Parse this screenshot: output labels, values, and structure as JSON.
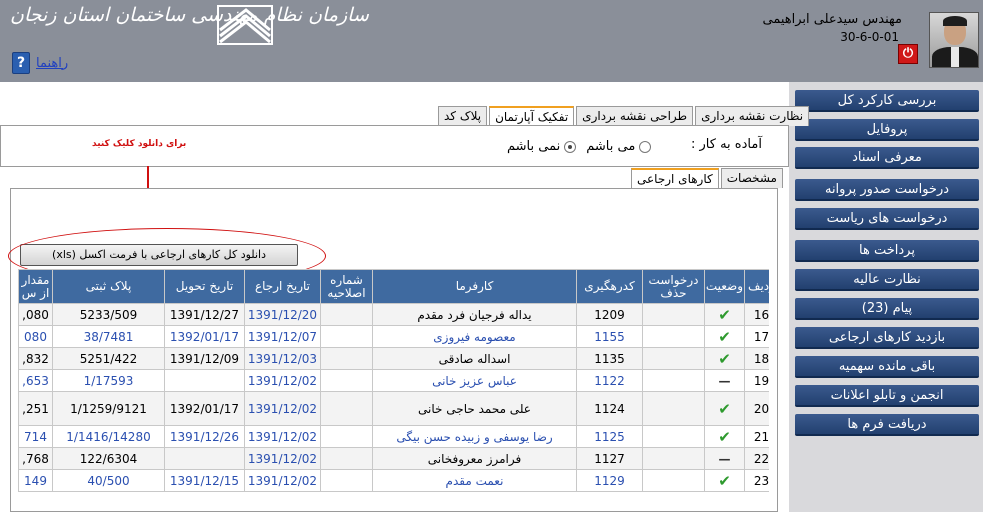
{
  "header": {
    "org_title": "سازمان نظام مهندسی ساختمان استان زنجان",
    "help_label": "راهنما",
    "user_name": "مهندس سیدعلی ابراهیمی",
    "user_code": "30-6-0-01"
  },
  "sidebar": {
    "items": [
      {
        "label": "بررسی کارکرد کل"
      },
      {
        "label": "پروفایل"
      },
      {
        "label": "معرفی اسناد"
      },
      {
        "label": "درخواست صدور پروانه"
      },
      {
        "label": "درخواست های ریاست"
      },
      {
        "label": "پرداخت ها"
      },
      {
        "label": "نظارت عالیه"
      },
      {
        "label": "پیام (23)"
      },
      {
        "label": "بازدید کارهای ارجاعی"
      },
      {
        "label": "باقی مانده سهمیه"
      },
      {
        "label": "انجمن و تابلو اعلانات"
      },
      {
        "label": "دریافت فرم ها"
      }
    ]
  },
  "tabs_top": [
    {
      "label": "پلاک کد"
    },
    {
      "label": "تفکیک آپارتمان"
    },
    {
      "label": "طراحی نقشه برداری"
    },
    {
      "label": "نظارت نقشه برداری"
    }
  ],
  "ready": {
    "label": "آماده به کار :",
    "opt_yes": "می باشم",
    "opt_no": "نمی باشم"
  },
  "download": {
    "hint": "برای دانلود کلیک کنید",
    "button_label": "دانلود کل کارهای ارجاعی با فرمت اکسل (xls)"
  },
  "tabs_inner": [
    {
      "label": "کارهای ارجاعی"
    },
    {
      "label": "مشخصات"
    }
  ],
  "table": {
    "headers": [
      "ردیف",
      "وضعیت",
      "درخواست حذف",
      "کدرهگیری",
      "کارفرما",
      "شماره اصلاحیه",
      "تاریخ ارجاع",
      "تاریخ تحویل",
      "پلاک ثبتی",
      "مقدار از س"
    ],
    "rows": [
      {
        "n": "16",
        "status": "check",
        "code": "1209",
        "employer": "یداله فرجیان فرد مقدم",
        "ref": "1391/12/20",
        "deliv": "1391/12/27",
        "plak": "5233/509",
        "amt": "080,",
        "blue": false
      },
      {
        "n": "17",
        "status": "check",
        "code": "1155",
        "employer": "معصومه فیروزی",
        "ref": "1391/12/07",
        "deliv": "1392/01/17",
        "plak": "38/7481",
        "amt": "080",
        "blue": true
      },
      {
        "n": "18",
        "status": "check",
        "code": "1135",
        "employer": "اسداله صادقی",
        "ref": "1391/12/03",
        "deliv": "1391/12/09",
        "plak": "5251/422",
        "amt": "832,",
        "blue": false
      },
      {
        "n": "19",
        "status": "dash",
        "code": "1122",
        "employer": "عباس عزیز خانی",
        "ref": "1391/12/02",
        "deliv": "",
        "plak": "1/17593",
        "amt": "653,",
        "blue": true
      },
      {
        "n": "20",
        "status": "check",
        "code": "1124",
        "employer": "علی محمد حاجی خانی",
        "ref": "1391/12/02",
        "deliv": "1392/01/17",
        "plak": "1/1259/9121",
        "amt": "251,",
        "blue": false,
        "tall": true
      },
      {
        "n": "21",
        "status": "check",
        "code": "1125",
        "employer": "رضا یوسفی و زبیده حسن بیگی",
        "ref": "1391/12/02",
        "deliv": "1391/12/26",
        "plak": "1/1416/14280",
        "amt": "714",
        "blue": true
      },
      {
        "n": "22",
        "status": "dash",
        "code": "1127",
        "employer": "فرامرز معروفخانی",
        "ref": "1391/12/02",
        "deliv": "",
        "plak": "122/6304",
        "amt": "768,",
        "blue": false
      },
      {
        "n": "23",
        "status": "check",
        "code": "1129",
        "employer": "نعمت مقدم",
        "ref": "1391/12/02",
        "deliv": "1391/12/15",
        "plak": "40/500",
        "amt": "149",
        "blue": true
      }
    ]
  }
}
